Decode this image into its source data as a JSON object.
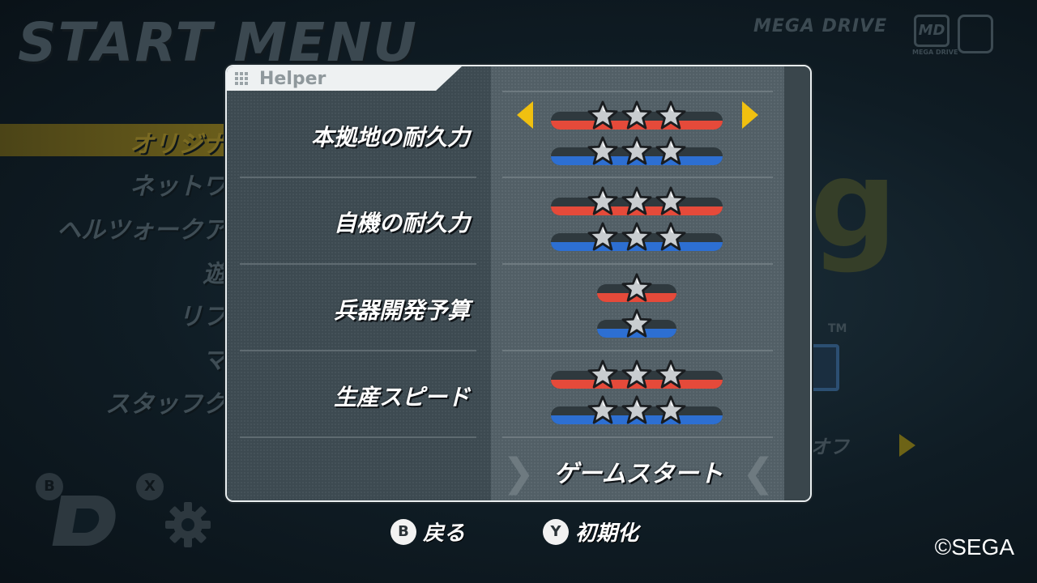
{
  "background": {
    "title": "START MENU",
    "brand": "MEGA DRIVE",
    "brand_logo": "MD",
    "brand_sub": "MEGA DRIVE",
    "menu_items": [
      "オリジナ",
      "ネットワ",
      "ヘルツォークア",
      "遊",
      "リフ",
      "マ",
      "スタッフク"
    ],
    "glyphs": [
      "g",
      "g"
    ],
    "trademark": "TM",
    "right_text": "オフ",
    "button_b": "B",
    "button_x": "X"
  },
  "dialog": {
    "tab_label": "Helper",
    "rows": [
      {
        "label": "本拠地の耐久力",
        "red_stars": 3,
        "blue_stars": 3,
        "selected": true
      },
      {
        "label": "自機の耐久力",
        "red_stars": 3,
        "blue_stars": 3,
        "selected": false
      },
      {
        "label": "兵器開発予算",
        "red_stars": 1,
        "blue_stars": 1,
        "selected": false
      },
      {
        "label": "生産スピード",
        "red_stars": 3,
        "blue_stars": 3,
        "selected": false
      }
    ],
    "start_label": "ゲームスタート",
    "chevron_left": "❯",
    "chevron_right": "❮"
  },
  "footer": {
    "back_key": "B",
    "back_label": "戻る",
    "reset_key": "Y",
    "reset_label": "初期化",
    "copyright": "©SEGA"
  },
  "colors": {
    "accent": "#f0c010",
    "player1": "#e54a3a",
    "player2": "#2d6fd2"
  }
}
